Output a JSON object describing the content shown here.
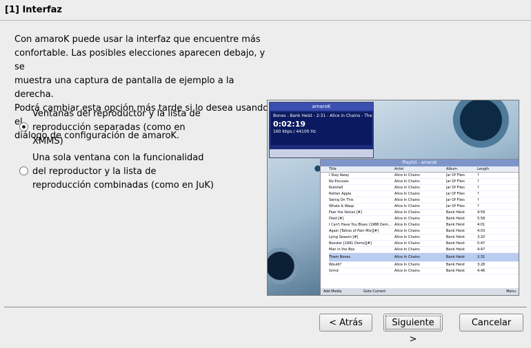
{
  "page_title": "[1] Interfaz",
  "intro": [
    "Con amaroK puede usar la interfaz que encuentre más",
    "confortable. Las posibles elecciones aparecen debajo, y se",
    "muestra una captura de pantalla de ejemplo a la derecha.",
    "Podrá cambiar esta opción más tarde si lo desea usando el",
    "diálogo de configuración de amaroK."
  ],
  "options": [
    {
      "lines": [
        "Ventanas del reproductor y la lista de",
        "reproducción separadas (como en",
        "XMMS)"
      ],
      "selected": true
    },
    {
      "lines": [
        "Una sola ventana con la funcionalidad",
        "del reproductor y la lista de",
        "reproducción combinadas (como en JuK)"
      ],
      "selected": false
    }
  ],
  "preview": {
    "player_title": "amaroK",
    "player_info": "Bones - Bank Heist - 2:31 - Alice in Chains - Then",
    "player_time": "0:02:19",
    "player_bitrate": "160 kbps / 44100 Hz",
    "playlist_title": "Playlist - amaroK",
    "columns": [
      "Title",
      "Artist",
      "Album",
      "Length"
    ],
    "rows": [
      [
        "I Stay Away",
        "Alice In Chains",
        "Jar Of Flies",
        "?"
      ],
      [
        "No Excuses",
        "Alice In Chains",
        "Jar Of Flies",
        "?"
      ],
      [
        "Nutshell",
        "Alice In Chains",
        "Jar Of Flies",
        "?"
      ],
      [
        "Rotten Apple",
        "Alice In Chains",
        "Jar Of Flies",
        "?"
      ],
      [
        "Swing On This",
        "Alice In Chains",
        "Jar Of Flies",
        "?"
      ],
      [
        "Whale & Wasp",
        "Alice In Chains",
        "Jar Of Flies",
        "?"
      ],
      [
        "Fear the Voices [#]",
        "Alice In Chains",
        "Bank Heist",
        "4:59"
      ],
      [
        "Died [#]",
        "Alice In Chains",
        "Bank Heist",
        "5:58"
      ],
      [
        "I Can't Have You Blues (1988 Dem...",
        "Alice In Chains",
        "Bank Heist",
        "4:01"
      ],
      [
        "Again [Tattoo of Pain Mix][#]",
        "Alice In Chains",
        "Bank Heist",
        "4:03"
      ],
      [
        "Lying Season [#]",
        "Alice In Chains",
        "Bank Heist",
        "3:20"
      ],
      [
        "Rooster [1991 Demo][#]",
        "Alice In Chains",
        "Bank Heist",
        "5:47"
      ],
      [
        "Man in the Box",
        "Alice In Chains",
        "Bank Heist",
        "4:47"
      ],
      [
        "Them Bones",
        "Alice In Chains",
        "Bank Heist",
        "2:31"
      ],
      [
        "Would?",
        "Alice In Chains",
        "Bank Heist",
        "3:28"
      ],
      [
        "Grind",
        "Alice In Chains",
        "Bank Heist",
        "4:46"
      ]
    ],
    "bottom_bar": [
      "Add Media",
      "Goto Current",
      "Menu"
    ]
  },
  "buttons": {
    "back": "< Atrás",
    "next": "Siguiente >",
    "cancel": "Cancelar"
  }
}
